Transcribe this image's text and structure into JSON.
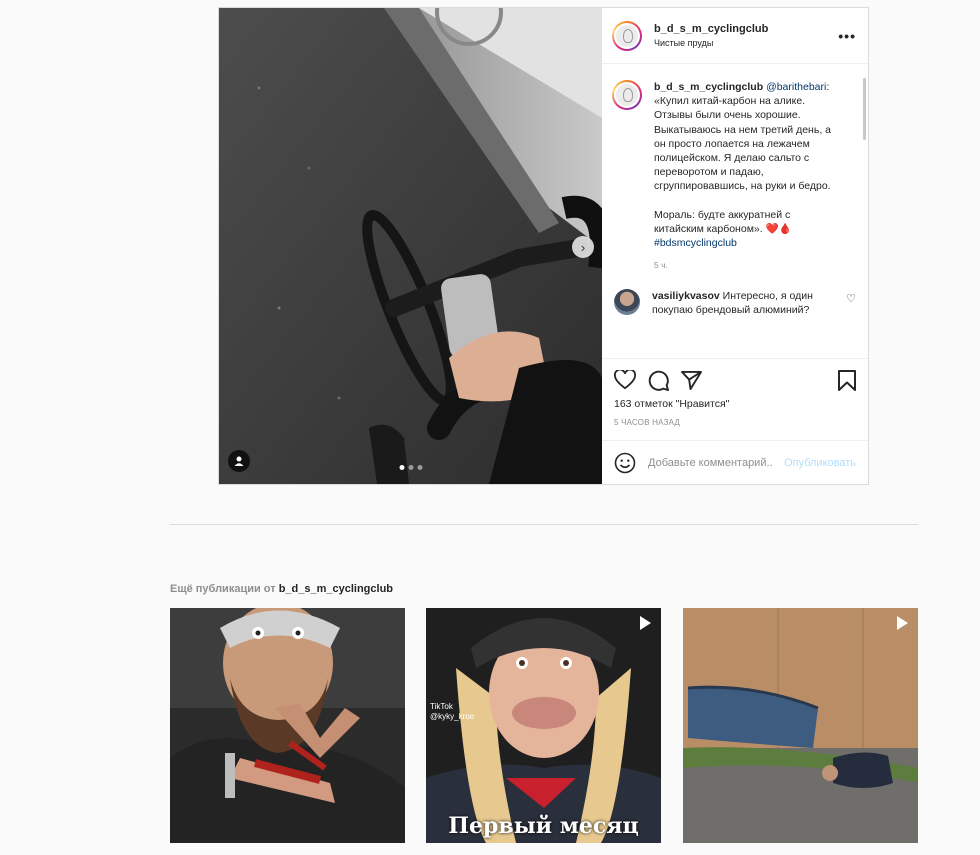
{
  "post": {
    "username": "b_d_s_m_cyclingclub",
    "location": "Чистые пруды",
    "caption": {
      "username": "b_d_s_m_cyclingclub",
      "mention": "@barithebari",
      "text": ": «Купил китай-карбон на алике. Отзывы были очень хорошие. Выкатываюсь на нем третий день, а он просто лопается на лежачем полицейском. Я делаю сальто с переворотом и падаю, сгруппировавшись, на руки и бедро.",
      "text2": "Мораль: будте аккуратней с китайским карбоном». ",
      "emoji": "❤️🩸",
      "hashtag": "#bdsmcyclingclub",
      "time": "5 ч."
    },
    "comments": [
      {
        "username": "vasiliykvasov",
        "text": "Интересно, я один покупаю брендовый алюминий?"
      }
    ],
    "likes": "163 отметок \"Нравится\"",
    "posted_ago": "5 ЧАСОВ НАЗАД",
    "comment_placeholder": "Добавьте комментарий...",
    "publish_label": "Опубликовать",
    "carousel": {
      "count": 3,
      "active": 0
    }
  },
  "more_posts": {
    "prefix": "Ещё публикации от ",
    "username": "b_d_s_m_cyclingclub",
    "items": [
      {
        "kind": "photo"
      },
      {
        "kind": "video",
        "tiktok_label": "TikTok",
        "tiktok_user": "@kyky_kroo",
        "caption": "Первый месяц"
      },
      {
        "kind": "video"
      }
    ]
  },
  "colors": {
    "link": "#00376b",
    "publish_disabled": "#b2dffc",
    "muted": "#8e8e8e"
  }
}
